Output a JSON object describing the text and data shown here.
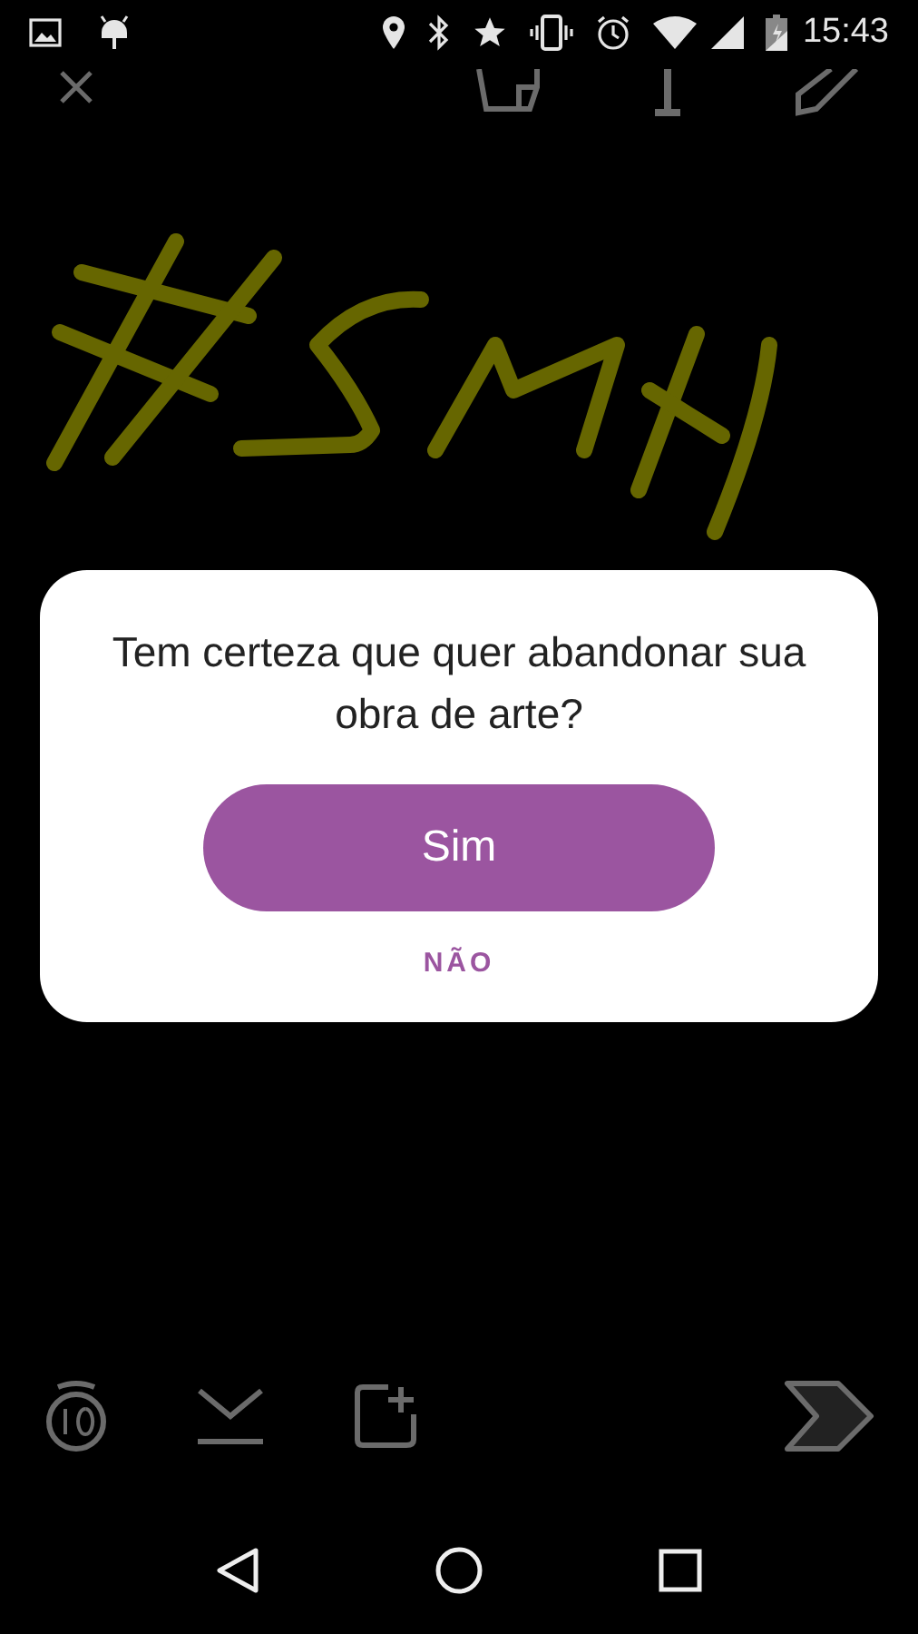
{
  "status_bar": {
    "time": "15:43"
  },
  "dialog": {
    "message": "Tem certeza que quer abandonar sua obra de arte?",
    "confirm_button": "Sim",
    "cancel_button": "NÃO"
  }
}
